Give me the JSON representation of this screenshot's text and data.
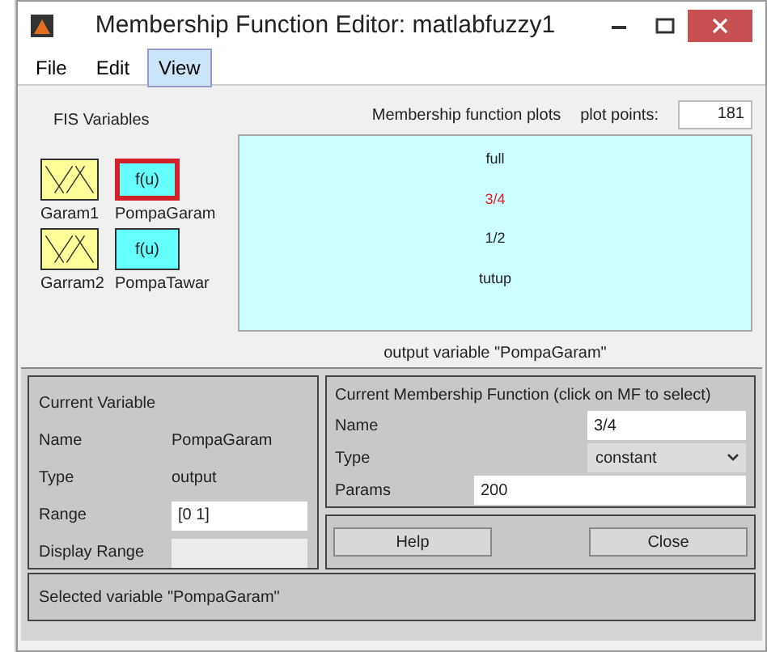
{
  "window": {
    "title": "Membership Function Editor: matlabfuzzy1"
  },
  "menu": [
    {
      "label": "File",
      "selected": false
    },
    {
      "label": "Edit",
      "selected": false
    },
    {
      "label": "View",
      "selected": true
    }
  ],
  "fis_variables": {
    "title": "FIS Variables",
    "items": [
      {
        "label": "Garam1",
        "kind": "input",
        "selected": false
      },
      {
        "label": "PompaGaram",
        "kind": "output",
        "icon_text": "f(u)",
        "selected": true
      },
      {
        "label": "Garram2",
        "kind": "input",
        "selected": false
      },
      {
        "label": "PompaTawar",
        "kind": "output",
        "icon_text": "f(u)",
        "selected": false
      }
    ]
  },
  "plot": {
    "title": "Membership function plots",
    "plot_points_label": "plot points:",
    "plot_points": "181",
    "caption": "output variable \"PompaGaram\"",
    "functions": [
      {
        "label": "full",
        "selected": false
      },
      {
        "label": "3/4",
        "selected": true
      },
      {
        "label": "1/2",
        "selected": false
      },
      {
        "label": "tutup",
        "selected": false
      }
    ]
  },
  "current_variable": {
    "title": "Current Variable",
    "name_label": "Name",
    "name": "PompaGaram",
    "type_label": "Type",
    "type": "output",
    "range_label": "Range",
    "range": "[0 1]",
    "display_range_label": "Display Range"
  },
  "current_mf": {
    "title": "Current Membership Function (click on MF to select)",
    "name_label": "Name",
    "name": "3/4",
    "type_label": "Type",
    "type": "constant",
    "params_label": "Params",
    "params": "200"
  },
  "buttons": [
    "Help",
    "Close"
  ],
  "status": "Selected variable \"PompaGaram\""
}
